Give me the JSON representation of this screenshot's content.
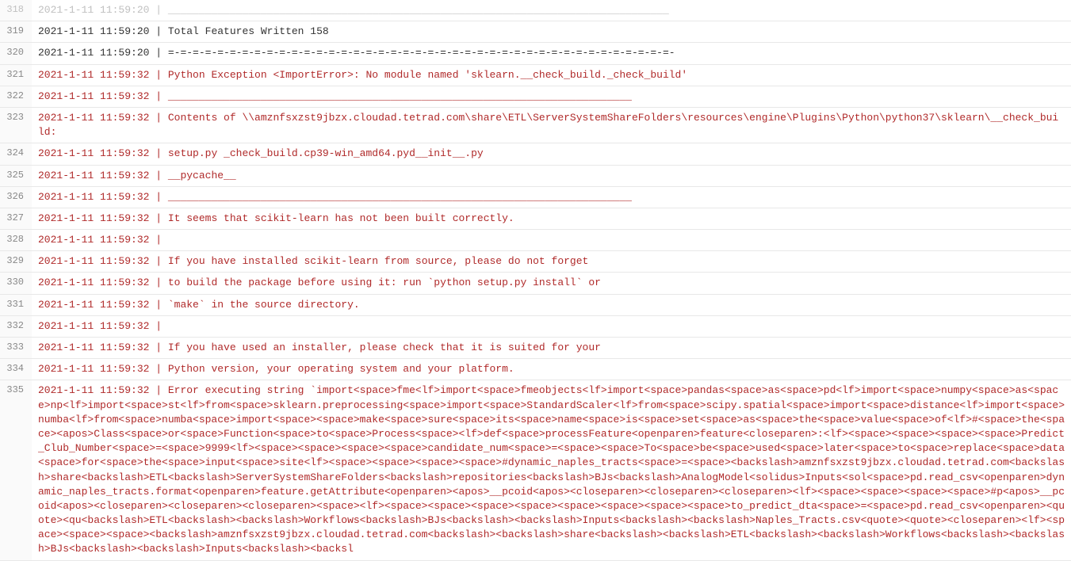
{
  "logs": [
    {
      "n": 318,
      "ts": "2021-1-11 11:59:20",
      "lvl": "normal",
      "msg": "_________________________________________________________________________________",
      "partial": true
    },
    {
      "n": 319,
      "ts": "2021-1-11 11:59:20",
      "lvl": "normal",
      "msg": "Total Features Written 158"
    },
    {
      "n": 320,
      "ts": "2021-1-11 11:59:20",
      "lvl": "normal",
      "msg": "=-=-=-=-=-=-=-=-=-=-=-=-=-=-=-=-=-=-=-=-=-=-=-=-=-=-=-=-=-=-=-=-=-=-=-=-=-=-=-=-=-"
    },
    {
      "n": 321,
      "ts": "2021-1-11 11:59:32",
      "lvl": "error",
      "msg": "Python Exception <ImportError>: No module named 'sklearn.__check_build._check_build'"
    },
    {
      "n": 322,
      "ts": "2021-1-11 11:59:32",
      "lvl": "error",
      "msg": "___________________________________________________________________________"
    },
    {
      "n": 323,
      "ts": "2021-1-11 11:59:32",
      "lvl": "error",
      "msg": "Contents of \\\\amznfsxzst9jbzx.cloudad.tetrad.com\\share\\ETL\\ServerSystemShareFolders\\resources\\engine\\Plugins\\Python\\python37\\sklearn\\__check_build:"
    },
    {
      "n": 324,
      "ts": "2021-1-11 11:59:32",
      "lvl": "error",
      "msg": "setup.py _check_build.cp39-win_amd64.pyd__init__.py"
    },
    {
      "n": 325,
      "ts": "2021-1-11 11:59:32",
      "lvl": "error",
      "msg": "__pycache__"
    },
    {
      "n": 326,
      "ts": "2021-1-11 11:59:32",
      "lvl": "error",
      "msg": "___________________________________________________________________________"
    },
    {
      "n": 327,
      "ts": "2021-1-11 11:59:32",
      "lvl": "error",
      "msg": "It seems that scikit-learn has not been built correctly."
    },
    {
      "n": 328,
      "ts": "2021-1-11 11:59:32",
      "lvl": "error",
      "msg": ""
    },
    {
      "n": 329,
      "ts": "2021-1-11 11:59:32",
      "lvl": "error",
      "msg": "If you have installed scikit-learn from source, please do not forget"
    },
    {
      "n": 330,
      "ts": "2021-1-11 11:59:32",
      "lvl": "error",
      "msg": "to build the package before using it: run `python setup.py install` or"
    },
    {
      "n": 331,
      "ts": "2021-1-11 11:59:32",
      "lvl": "error",
      "msg": "`make` in the source directory."
    },
    {
      "n": 332,
      "ts": "2021-1-11 11:59:32",
      "lvl": "error",
      "msg": ""
    },
    {
      "n": 333,
      "ts": "2021-1-11 11:59:32",
      "lvl": "error",
      "msg": "If you have used an installer, please check that it is suited for your"
    },
    {
      "n": 334,
      "ts": "2021-1-11 11:59:32",
      "lvl": "error",
      "msg": "Python version, your operating system and your platform."
    },
    {
      "n": 335,
      "ts": "2021-1-11 11:59:32",
      "lvl": "error",
      "msg": "Error executing string `import<space>fme<lf>import<space>fmeobjects<lf>import<space>pandas<space>as<space>pd<lf>import<space>numpy<space>as<space>np<lf>import<space>st<lf>from<space>sklearn.preprocessing<space>import<space>StandardScaler<lf>from<space>scipy.spatial<space>import<space>distance<lf>import<space>numba<lf>from<space>numba<space>import<space><space>make<space>sure<space>its<space>name<space>is<space>set<space>as<space>the<space>value<space>of<lf>#<space>the<space><apos>Class<space>or<space>Function<space>to<space>Process<space><lf>def<space>processFeature<openparen>feature<closeparen>:<lf><space><space><space><space>Predict_Club_Number<space>=<space>9999<lf><space><space><space><space>candidate_num<space>=<space><space>To<space>be<space>used<space>later<space>to<space>replace<space>data<space>for<space>the<space>input<space>site<lf><space><space><space><space>#dynamic_naples_tracts<space>=<space><backslash>amznfsxzst9jbzx.cloudad.tetrad.com<backslash>share<backslash>ETL<backslash>ServerSystemShareFolders<backslash>repositories<backslash>BJs<backslash>AnalogModel<solidus>Inputs<sol<space>pd.read_csv<openparen>dynamic_naples_tracts.format<openparen>feature.getAttribute<openparen><apos>__pcoid<apos><closeparen><closeparen><closeparen><lf><space><space><space><space>#p<apos>__pcoid<apos><closeparen><closeparen><closeparen><space><lf><space><space><space><space><space><space><space><space>to_predict_dta<space>=<space>pd.read_csv<openparen><quote><qu<backslash>ETL<backslash><backslash>Workflows<backslash>BJs<backslash><backslash>Inputs<backslash><backslash>Naples_Tracts.csv<quote><quote><closeparen><lf><space><space><space><backslash>amznfsxzst9jbzx.cloudad.tetrad.com<backslash><backslash>share<backslash><backslash>ETL<backslash><backslash>Workflows<backslash><backslash>BJs<backslash><backslash>Inputs<backslash><backsl"
    }
  ]
}
